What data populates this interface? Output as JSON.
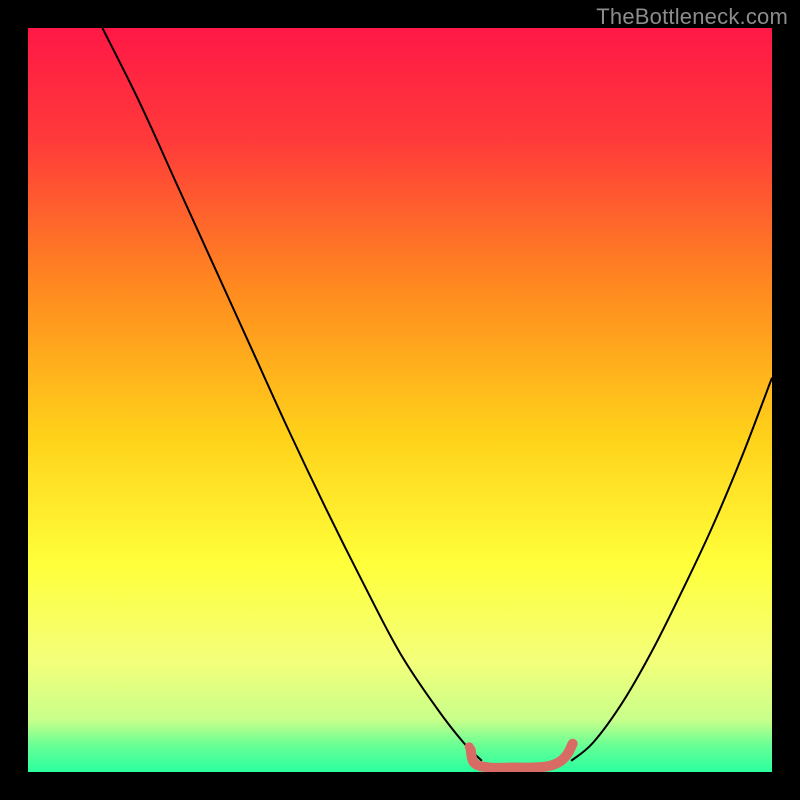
{
  "watermark": "TheBottleneck.com",
  "chart_data": {
    "type": "line",
    "title": "",
    "xlabel": "",
    "ylabel": "",
    "xlim": [
      0,
      100
    ],
    "ylim": [
      0,
      100
    ],
    "grid": false,
    "legend": false,
    "gradient_stops": [
      {
        "offset": 0.0,
        "color": "#ff1846"
      },
      {
        "offset": 0.15,
        "color": "#ff3a3a"
      },
      {
        "offset": 0.35,
        "color": "#ff8a1f"
      },
      {
        "offset": 0.55,
        "color": "#ffd21a"
      },
      {
        "offset": 0.72,
        "color": "#ffff3a"
      },
      {
        "offset": 0.85,
        "color": "#f4ff7a"
      },
      {
        "offset": 0.93,
        "color": "#c8ff8a"
      },
      {
        "offset": 0.965,
        "color": "#66ff95"
      },
      {
        "offset": 1.0,
        "color": "#2aff9f"
      }
    ],
    "series": [
      {
        "name": "bottleneck-curve-left",
        "color": "#000000",
        "width": 2,
        "x": [
          10.0,
          15.0,
          20.0,
          25.0,
          30.0,
          35.0,
          40.0,
          45.0,
          50.0,
          55.0,
          58.5,
          61.0
        ],
        "y": [
          100.0,
          90.0,
          79.0,
          68.0,
          57.0,
          46.0,
          35.5,
          25.5,
          16.0,
          8.5,
          4.0,
          1.5
        ]
      },
      {
        "name": "bottleneck-curve-right",
        "color": "#000000",
        "width": 2,
        "x": [
          73.0,
          76.0,
          80.0,
          84.0,
          88.0,
          92.0,
          96.0,
          100.0
        ],
        "y": [
          1.5,
          4.0,
          9.5,
          16.5,
          24.5,
          33.0,
          42.5,
          53.0
        ]
      },
      {
        "name": "optimal-range",
        "color": "#d96b65",
        "width": 10,
        "linecap": "round",
        "x": [
          59.5,
          60.0,
          62.0,
          65.0,
          68.0,
          70.0,
          71.5,
          72.5,
          73.2
        ],
        "y": [
          3.0,
          1.2,
          0.6,
          0.6,
          0.6,
          0.8,
          1.4,
          2.4,
          3.8
        ]
      }
    ],
    "optimal_dot": {
      "x": 59.3,
      "y": 3.4,
      "r": 4.5,
      "color": "#d96b65"
    }
  }
}
